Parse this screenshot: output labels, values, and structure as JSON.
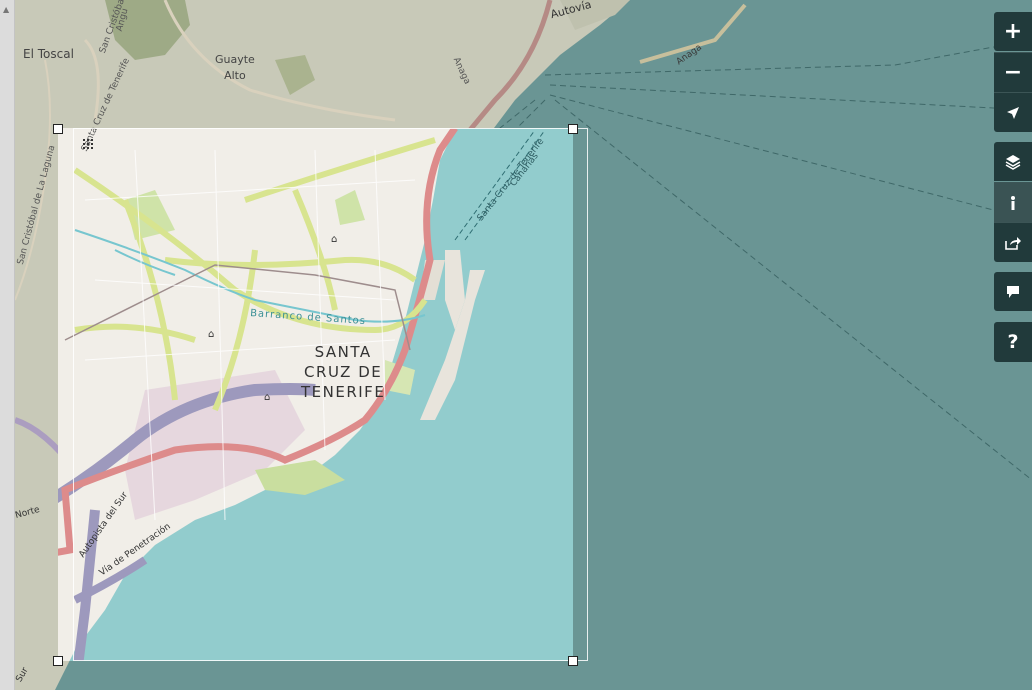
{
  "map": {
    "place_labels": {
      "el_toscal": "El Toscal",
      "guayte_alto": "Guayte\nAlto",
      "city": "SANTA\nCRUZ DE\nTENERIFE"
    },
    "road_labels": {
      "autovia": "Autovía",
      "anaga": "Anaga",
      "anaga_sea": "Anaga",
      "san_cristobal": "San Cristóbal",
      "santa_cruz_tenerife_top": "Santa Cruz de Tenerife",
      "san_cristobal_laguna": "San Cristóbal de La Laguna",
      "santa_cruz_tenerife_port": "Santa Cruz de Tenerife",
      "canarias": "Canarias",
      "barranco": "Barranco de Santos",
      "autopista_sur": "Autopista del Sur",
      "via_penetracion": "Vía de Penetración",
      "norte": "Norte",
      "sur": "Sur",
      "angu": "Angu"
    }
  },
  "controls": {
    "zoom_in": "+",
    "zoom_out": "−",
    "help": "?"
  },
  "colors": {
    "sea_outer": "#6a9594",
    "sea_inner": "#92cccd",
    "land": "#f1eee8",
    "control_bg": "#213a3b",
    "motorway": "#9d99bd",
    "trunk": "#dd8b8b",
    "primary": "#d8e48f"
  },
  "icons": [
    "zoom-in-icon",
    "zoom-out-icon",
    "locate-icon",
    "layers-icon",
    "info-icon",
    "share-icon",
    "comment-icon",
    "help-icon",
    "grid-icon"
  ]
}
